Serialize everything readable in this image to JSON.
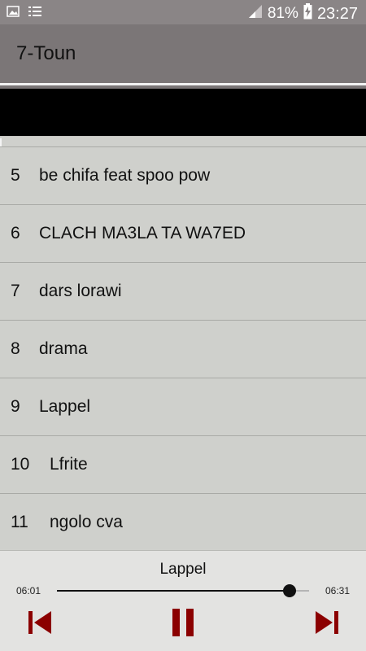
{
  "status_bar": {
    "battery": "81%",
    "time": "23:27"
  },
  "app_bar": {
    "title": "7-Toun"
  },
  "tracks": [
    {
      "number": "5",
      "name": "be chifa feat spoo pow"
    },
    {
      "number": "6",
      "name": "CLACH MA3LA TA WA7ED"
    },
    {
      "number": "7",
      "name": "dars lorawi"
    },
    {
      "number": "8",
      "name": "drama"
    },
    {
      "number": "9",
      "name": "Lappel"
    },
    {
      "number": "10",
      "name": "Lfrite"
    },
    {
      "number": "11",
      "name": "ngolo cva"
    }
  ],
  "player": {
    "now_playing": "Lappel",
    "elapsed": "06:01",
    "total": "06:31",
    "progress": 0.924
  },
  "colors": {
    "control_accent": "#8b0000",
    "app_bar": "#7b7677",
    "status_bar": "#8a8586"
  },
  "icons": {
    "status_left": [
      "image-icon",
      "list-icon"
    ],
    "status_right": [
      "signal-icon",
      "battery-charging-icon"
    ],
    "controls": [
      "skip-previous-icon",
      "pause-icon",
      "skip-next-icon"
    ]
  }
}
